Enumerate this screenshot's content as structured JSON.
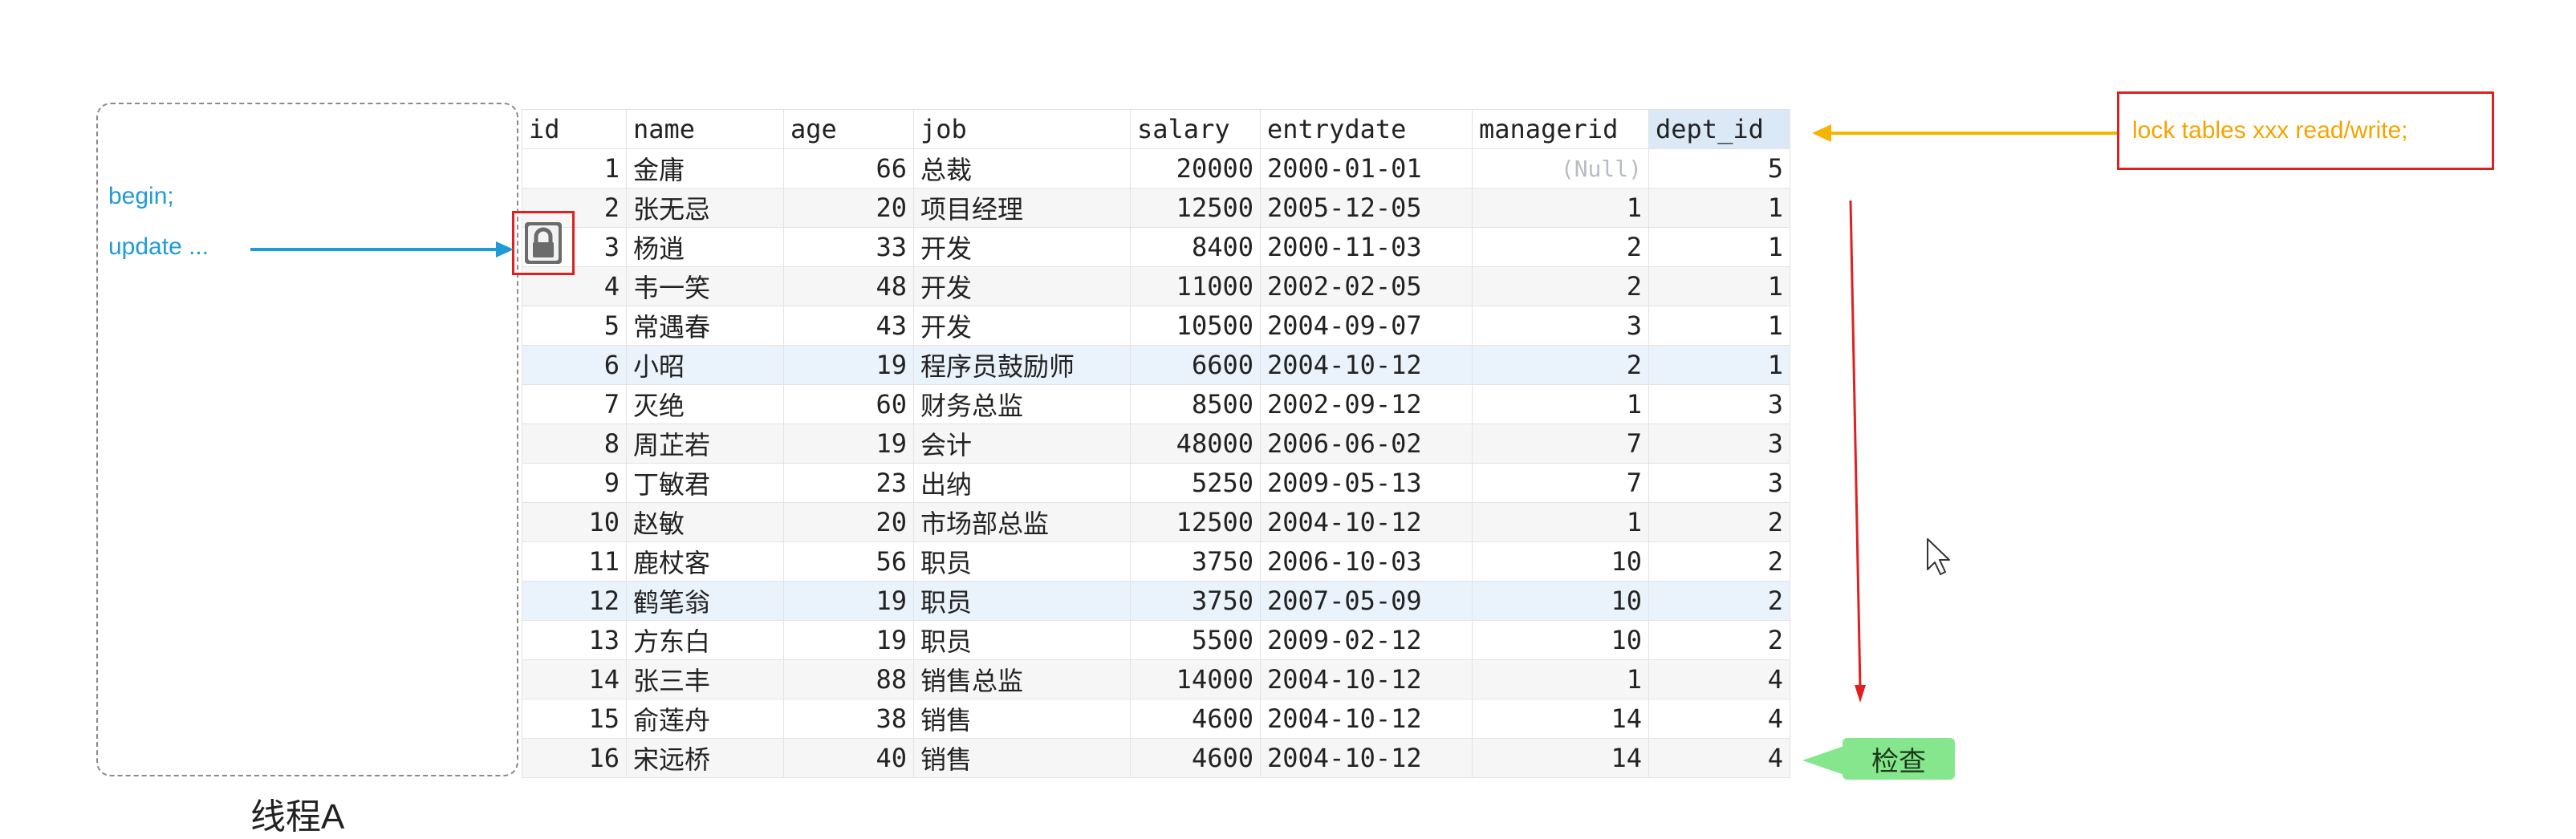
{
  "thread": {
    "code": [
      "begin;",
      "update ..."
    ],
    "label": "线程A"
  },
  "lock_note": "lock tables xxx read/write;",
  "check_label": "检查",
  "table": {
    "columns": [
      "id",
      "name",
      "age",
      "job",
      "salary",
      "entrydate",
      "managerid",
      "dept_id"
    ],
    "selected_column": "dept_id",
    "rows": [
      [
        "1",
        "金庸",
        "66",
        "总裁",
        "20000",
        "2000-01-01",
        "(Null)",
        "5"
      ],
      [
        "2",
        "张无忌",
        "20",
        "项目经理",
        "12500",
        "2005-12-05",
        "1",
        "1"
      ],
      [
        "3",
        "杨逍",
        "33",
        "开发",
        "8400",
        "2000-11-03",
        "2",
        "1"
      ],
      [
        "4",
        "韦一笑",
        "48",
        "开发",
        "11000",
        "2002-02-05",
        "2",
        "1"
      ],
      [
        "5",
        "常遇春",
        "43",
        "开发",
        "10500",
        "2004-09-07",
        "3",
        "1"
      ],
      [
        "6",
        "小昭",
        "19",
        "程序员鼓励师",
        "6600",
        "2004-10-12",
        "2",
        "1"
      ],
      [
        "7",
        "灭绝",
        "60",
        "财务总监",
        "8500",
        "2002-09-12",
        "1",
        "3"
      ],
      [
        "8",
        "周芷若",
        "19",
        "会计",
        "48000",
        "2006-06-02",
        "7",
        "3"
      ],
      [
        "9",
        "丁敏君",
        "23",
        "出纳",
        "5250",
        "2009-05-13",
        "7",
        "3"
      ],
      [
        "10",
        "赵敏",
        "20",
        "市场部总监",
        "12500",
        "2004-10-12",
        "1",
        "2"
      ],
      [
        "11",
        "鹿杖客",
        "56",
        "职员",
        "3750",
        "2006-10-03",
        "10",
        "2"
      ],
      [
        "12",
        "鹤笔翁",
        "19",
        "职员",
        "3750",
        "2007-05-09",
        "10",
        "2"
      ],
      [
        "13",
        "方东白",
        "19",
        "职员",
        "5500",
        "2009-02-12",
        "10",
        "2"
      ],
      [
        "14",
        "张三丰",
        "88",
        "销售总监",
        "14000",
        "2004-10-12",
        "1",
        "4"
      ],
      [
        "15",
        "俞莲舟",
        "38",
        "销售",
        "4600",
        "2004-10-12",
        "14",
        "4"
      ],
      [
        "16",
        "宋远桥",
        "40",
        "销售",
        "4600",
        "2004-10-12",
        "14",
        "4"
      ]
    ]
  },
  "icons": {
    "lock": "lock-icon",
    "cursor": "mouse-cursor-icon"
  },
  "colors": {
    "thread_text": "#1f9bd7",
    "note_text": "#f4a400",
    "highlight_red": "#e02020",
    "badge_green": "#86e68d"
  }
}
